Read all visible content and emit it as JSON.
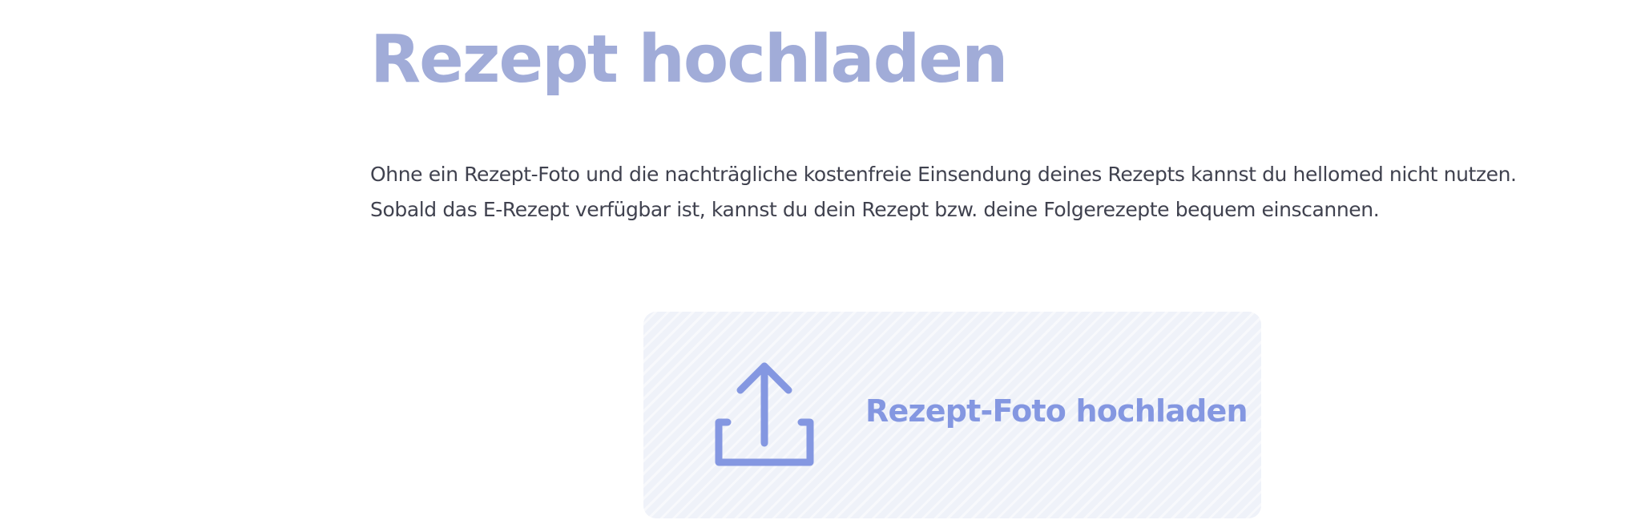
{
  "header": {
    "title": "Rezept hochladen"
  },
  "intro": {
    "text": "Ohne ein Rezept-Foto und die nachträgliche kostenfreie Einsendung deines Rezepts kannst du hellomed nicht nutzen. Sobald das E-Rezept verfügbar ist, kannst du dein Rezept bzw. deine Folgerezepte bequem einscannen."
  },
  "upload": {
    "label": "Rezept-Foto hochladen",
    "icon": "upload-icon"
  },
  "colors": {
    "title": "#a1acd8",
    "body_text": "#40424f",
    "accent": "#8497e1",
    "upload_background": "#eff2f9"
  }
}
